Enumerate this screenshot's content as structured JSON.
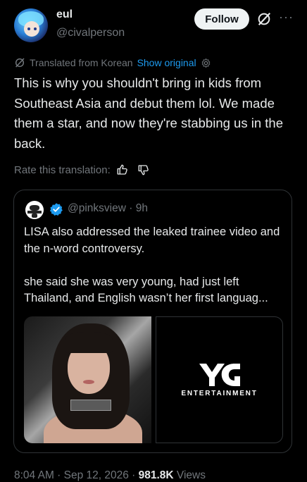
{
  "author": {
    "name": "eul",
    "handle": "@civalperson",
    "follow_label": "Follow"
  },
  "translation": {
    "label": "Translated from Korean",
    "show_original": "Show original",
    "rate_label": "Rate this translation:"
  },
  "tweet": {
    "text": "This is why you shouldn't bring in kids from Southeast Asia and debut them lol. We made them a star, and now they're stabbing us in the back."
  },
  "quote": {
    "handle": "@pinksview · 9h",
    "text": "LISA also addressed the leaked trainee video and the n-word controversy.\n\nshe said she was very young, had just left Thailand, and English wasn’t her first languag...",
    "media_right_label": "ENTERTAINMENT"
  },
  "footer": {
    "time": "8:04 AM · Sep 12, 2026 · ",
    "views_count": "981.8K",
    "views_label": " Views"
  },
  "colors": {
    "accent": "#1d9bf0",
    "background": "#000000",
    "muted": "#71767b",
    "text": "#e7e9ea"
  },
  "icons": [
    "grok-icon",
    "more-icon",
    "translate-icon",
    "gear-icon",
    "thumbs-up-icon",
    "thumbs-down-icon",
    "verified-badge-icon"
  ]
}
